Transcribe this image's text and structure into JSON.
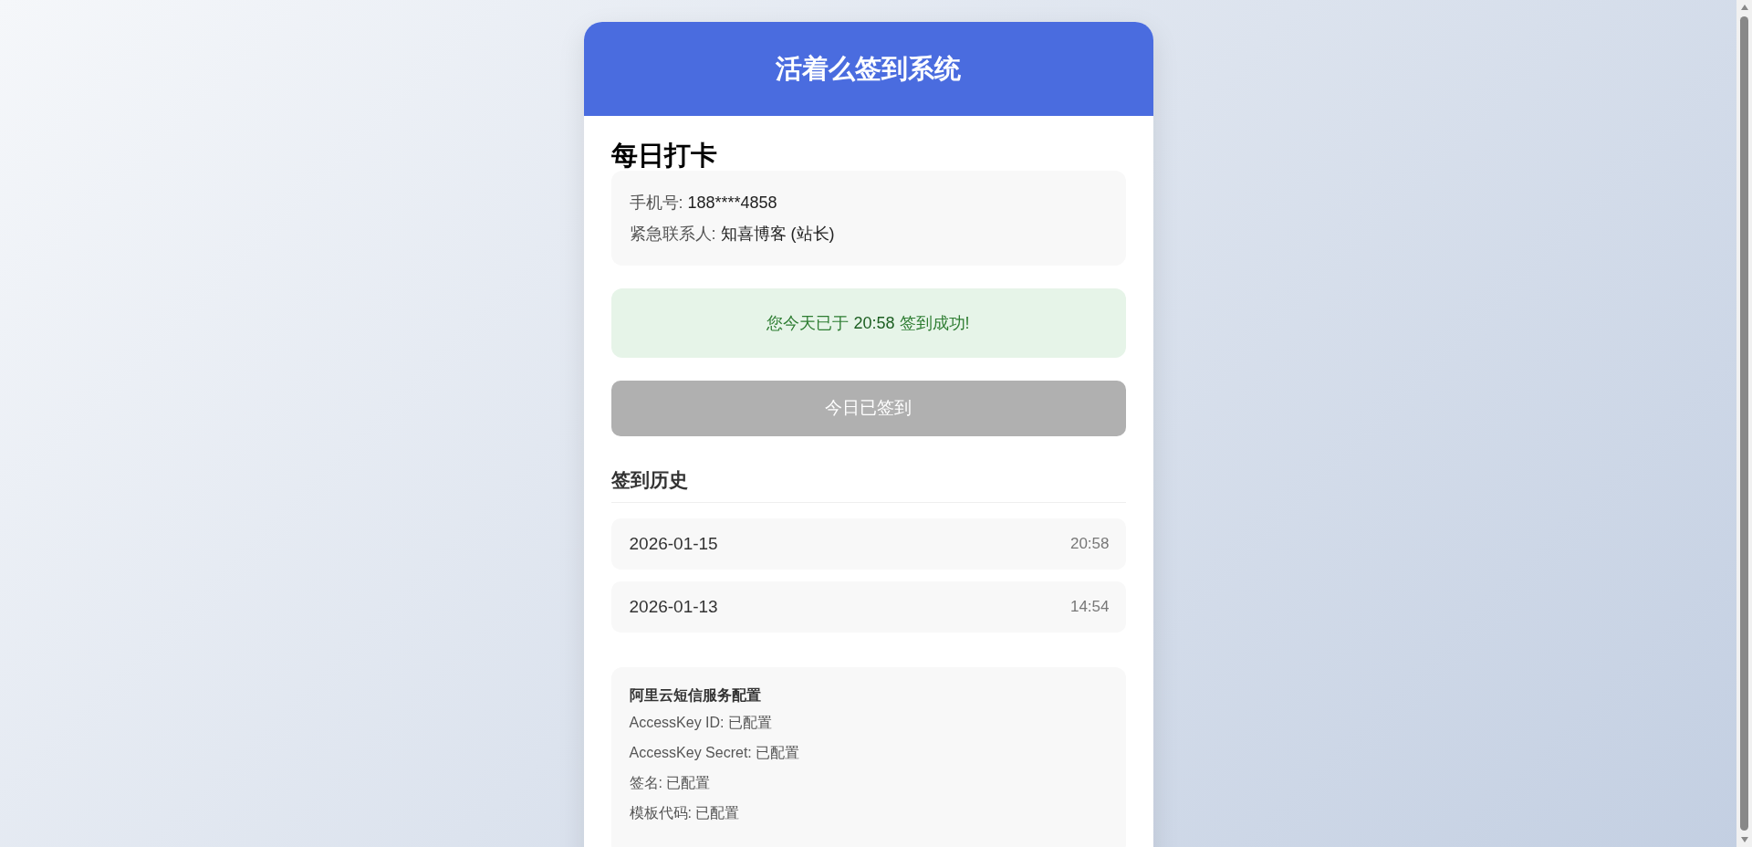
{
  "header": {
    "title": "活着么签到系统"
  },
  "checkin": {
    "title": "每日打卡",
    "info": [
      {
        "label": "手机号:",
        "value": "188****4858"
      },
      {
        "label": "紧急联系人:",
        "value": "知喜博客 (站长)"
      }
    ],
    "status": {
      "prefix": "您今天已于",
      "time": "20:58",
      "suffix": "签到成功!"
    },
    "button": {
      "label": "今日已签到",
      "disabled": true
    }
  },
  "history": {
    "title": "签到历史",
    "rows": [
      {
        "date": "2026-01-15",
        "time": "20:58"
      },
      {
        "date": "2026-01-13",
        "time": "14:54"
      }
    ]
  },
  "config": {
    "title": "阿里云短信服务配置",
    "items": [
      {
        "label": "AccessKey ID:",
        "value": "已配置"
      },
      {
        "label": "AccessKey Secret:",
        "value": "已配置"
      },
      {
        "label": "签名:",
        "value": "已配置"
      },
      {
        "label": "模板代码:",
        "value": "已配置"
      }
    ]
  }
}
